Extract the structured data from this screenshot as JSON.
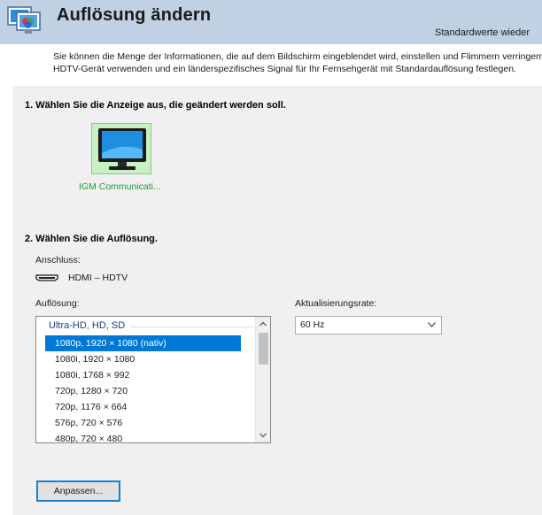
{
  "header": {
    "title": "Auflösung ändern",
    "restore_defaults": "Standardwerte wieder"
  },
  "intro": {
    "line1": "Sie können die Menge der Informationen, die auf dem Bildschirm eingeblendet wird, einstellen und Flimmern verringern.",
    "line2": "HDTV-Gerät verwenden und ein länderspezifisches Signal für Ihr Fernsehgerät mit Standardauflösung festlegen."
  },
  "step1": {
    "title": "1. Wählen Sie die Anzeige aus, die geändert werden soll.",
    "display_name": "IGM Communicati..."
  },
  "step2": {
    "title": "2. Wählen Sie die Auflösung.",
    "connection_label": "Anschluss:",
    "connection_value": "HDMI – HDTV",
    "resolution_label": "Auflösung:",
    "refresh_label": "Aktualisierungsrate:",
    "refresh_value": "60 Hz",
    "group_header": "Ultra-HD, HD, SD",
    "resolutions": [
      "1080p, 1920 × 1080 (nativ)",
      "1080i, 1920 × 1080",
      "1080i, 1768 × 992",
      "720p, 1280 × 720",
      "720p, 1176 × 664",
      "576p, 720 × 576",
      "480p, 720 × 480"
    ],
    "selected_index": 0,
    "customize_button": "Anpassen..."
  },
  "icons": {
    "app": "display-settings-icon",
    "monitor": "monitor-icon",
    "connector": "hdmi-connector-icon"
  },
  "colors": {
    "header_bg": "#bfd1e3",
    "selection": "#0078d7",
    "display_tile": "#c8f0c4",
    "display_label": "#1e9a34"
  }
}
